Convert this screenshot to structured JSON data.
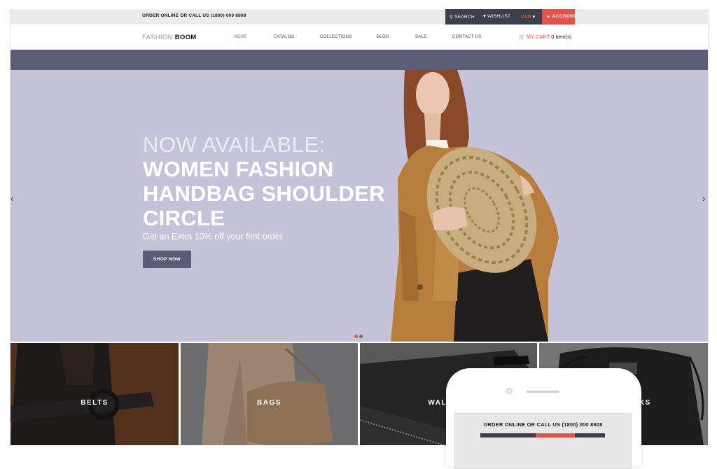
{
  "topbar": {
    "order_text": "ORDER ONLINE OR CALL US (1800) 000 8808",
    "search_label": "SEARCH",
    "wishlist_label": "WISHLIST",
    "currency_label": "USD",
    "account_label": "ACCOUNT"
  },
  "nav": {
    "logo_light": "FASHION",
    "logo_bold": "BOOM",
    "items": [
      {
        "label": "HOME"
      },
      {
        "label": "CATALOG"
      },
      {
        "label": "COLLECTIONS"
      },
      {
        "label": "BLOG"
      },
      {
        "label": "SALE"
      },
      {
        "label": "CONTACT US"
      }
    ],
    "cart_label": "MY CART",
    "cart_count": "0 item(s)"
  },
  "hero": {
    "line1": "NOW AVAILABLE:",
    "line2": "WOMEN FASHION",
    "line3": "HANDBAG SHOULDER",
    "line4": "CIRCLE",
    "subtitle": "Get an Extra 10% off your first order",
    "button_label": "SHOP NOW",
    "prev_arrow": "‹",
    "next_arrow": "›",
    "slide_count": 2,
    "active_slide": 1
  },
  "categories": [
    {
      "label": "BELTS"
    },
    {
      "label": "BAGS"
    },
    {
      "label": "WALLETS"
    },
    {
      "label": "BACKPACKS"
    }
  ],
  "phone": {
    "order_text": "ORDER ONLINE OR CALL US (1800) 000 8808"
  },
  "colors": {
    "accent": "#e4534a",
    "dark": "#3c3f4c",
    "hero_bg": "#c4c3da",
    "band": "#5c5e79"
  },
  "icons": {
    "search": "search-icon",
    "wishlist": "heart-icon",
    "currency": "chevron-down-icon",
    "account": "user-icon",
    "cart": "cart-icon"
  }
}
